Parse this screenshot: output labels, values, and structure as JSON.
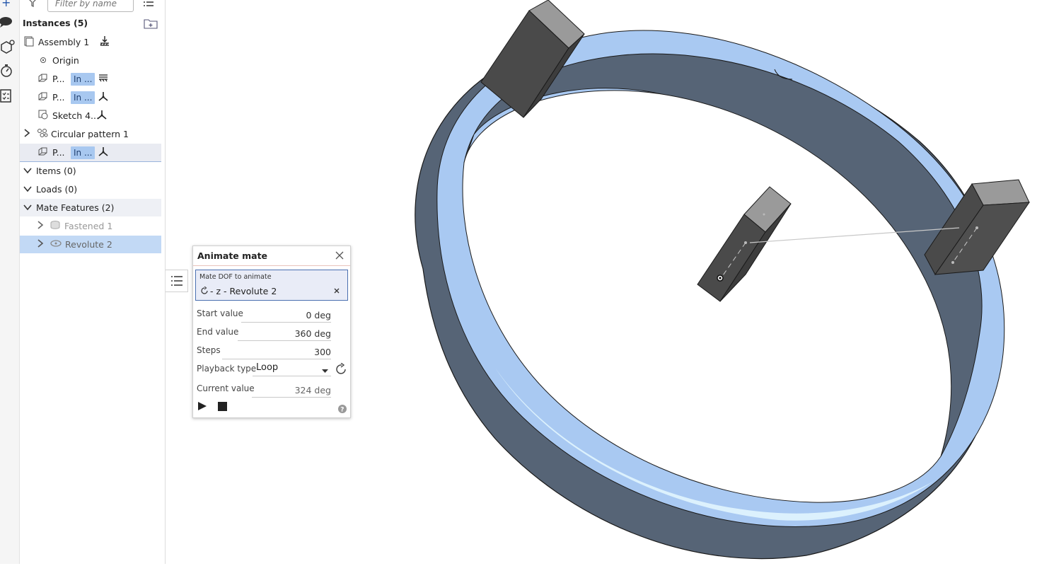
{
  "filter": {
    "placeholder": "Filter by name"
  },
  "instances": {
    "header": "Instances (5)",
    "items": [
      {
        "label": "Assembly 1"
      },
      {
        "label": "Origin"
      },
      {
        "label": "P...",
        "badge": "In ..."
      },
      {
        "label": "P...",
        "badge": "In ..."
      },
      {
        "label": "Sketch 4..."
      },
      {
        "label": "Circular pattern 1"
      },
      {
        "label": "P...",
        "badge": "In ..."
      }
    ]
  },
  "sections": {
    "items": "Items (0)",
    "loads": "Loads (0)",
    "mate_features": "Mate Features (2)"
  },
  "mates": [
    {
      "label": "Fastened 1"
    },
    {
      "label": "Revolute 2"
    }
  ],
  "dialog": {
    "title": "Animate mate",
    "dof_label": "Mate DOF to animate",
    "dof_value": "- z - Revolute 2",
    "start_label": "Start value",
    "start_value": "0 deg",
    "end_label": "End value",
    "end_value": "360 deg",
    "steps_label": "Steps",
    "steps_value": "300",
    "playback_label": "Playback type",
    "playback_value": "Loop",
    "current_label": "Current value",
    "current_value": "324 deg"
  },
  "colors": {
    "ring_outer": "#566476",
    "ring_top": "#a9c9f2",
    "block_dark": "#4a4a4a",
    "block_top": "#9a9a9a",
    "selection": "#c2d9f5",
    "badge": "#a8c8f0"
  }
}
